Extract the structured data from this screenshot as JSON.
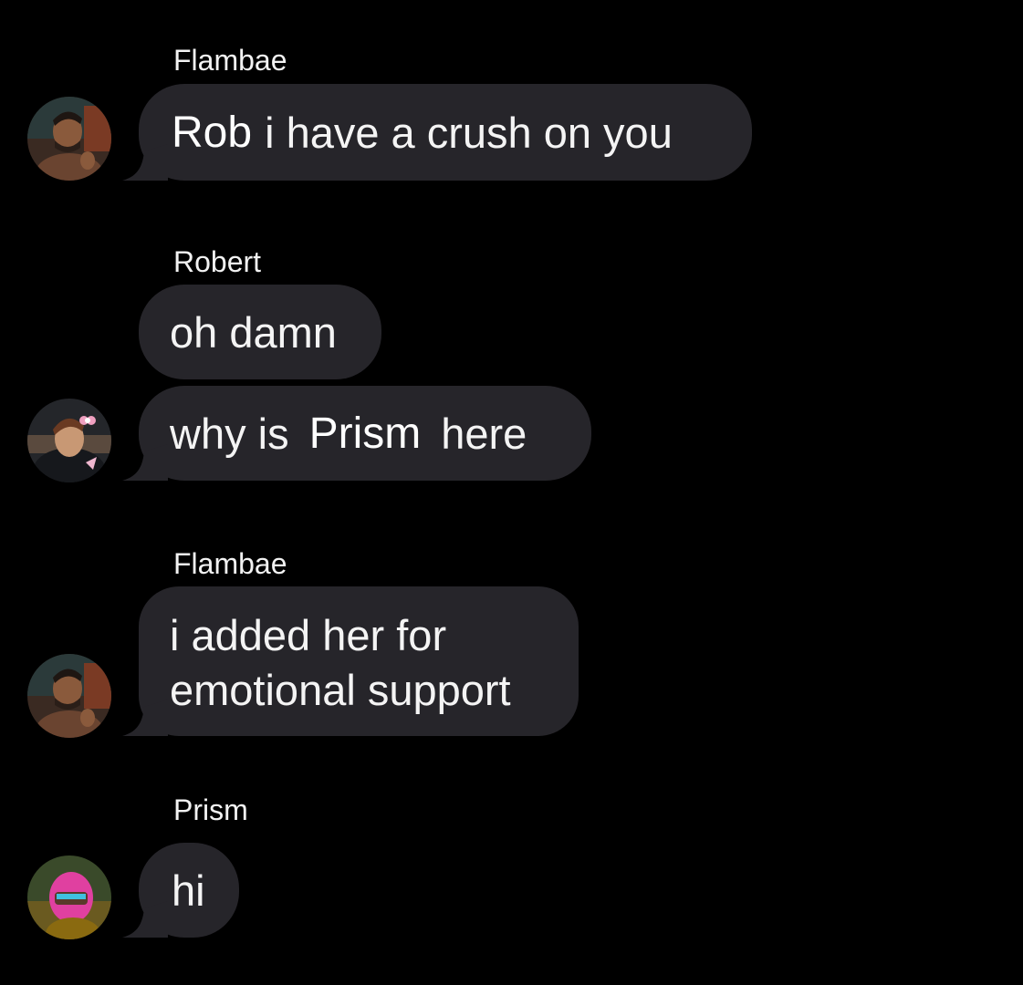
{
  "thread": {
    "messages": [
      {
        "sender": "Flambae",
        "parts": [
          {
            "text": "Rob",
            "style": "tag"
          },
          {
            "text": "i have a crush on you",
            "style": "normal"
          }
        ]
      },
      {
        "sender": "Robert",
        "parts": [
          {
            "text": "oh damn",
            "style": "normal"
          }
        ]
      },
      {
        "sender": "",
        "parts": [
          {
            "text": "why is",
            "style": "normal"
          },
          {
            "text": "Prism",
            "style": "tag"
          },
          {
            "text": "here",
            "style": "normal"
          }
        ]
      },
      {
        "sender": "Flambae",
        "lines": [
          "i added her for",
          "emotional support"
        ]
      },
      {
        "sender": "Prism",
        "parts": [
          {
            "text": "hi",
            "style": "normal"
          }
        ]
      }
    ],
    "avatars": [
      {
        "name": "Flambae",
        "icon": "flambae-avatar-icon"
      },
      {
        "name": "Robert",
        "icon": "robert-avatar-icon"
      },
      {
        "name": "Flambae",
        "icon": "flambae-avatar-icon"
      },
      {
        "name": "Prism",
        "icon": "prism-avatar-icon"
      }
    ]
  },
  "colors": {
    "background": "#000000",
    "bubble": "#26252a",
    "text": "#f4f4f4"
  }
}
